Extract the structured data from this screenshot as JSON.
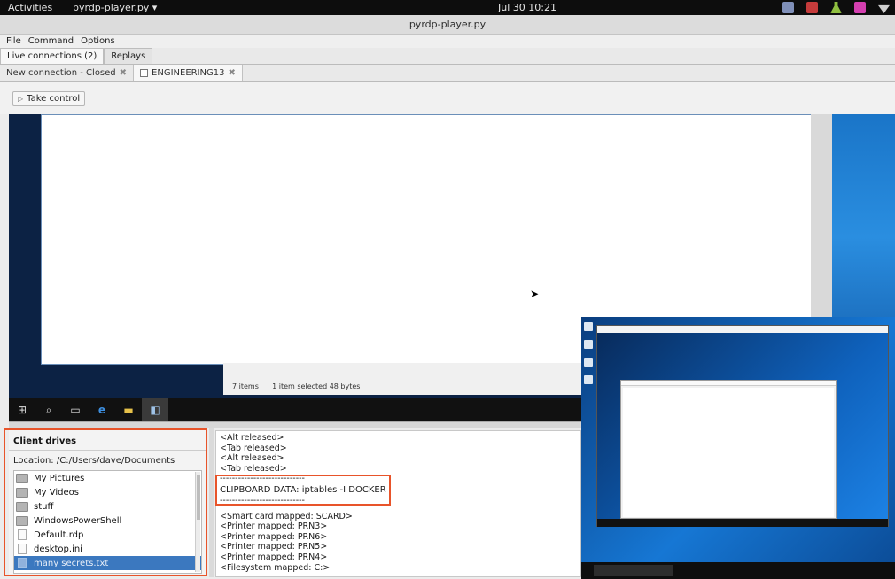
{
  "topbar": {
    "activities": "Activities",
    "app_menu": "pyrdp-player.py ▾",
    "clock": "Jul 30  10:21",
    "tray_icons": [
      "app-icon-1",
      "app-icon-2",
      "flask-icon",
      "app-icon-3",
      "network-icon"
    ]
  },
  "window": {
    "title": "pyrdp-player.py"
  },
  "menubar": {
    "items": [
      "File",
      "Command",
      "Options"
    ]
  },
  "top_tabs": [
    {
      "label": "Live connections (2)",
      "active": true
    },
    {
      "label": "Replays",
      "active": false
    }
  ],
  "conn_tabs": [
    {
      "label": "New connection - Closed",
      "active": false
    },
    {
      "label": "ENGINEERING13",
      "active": true
    }
  ],
  "toolbar": {
    "take_control": "Take control"
  },
  "remote": {
    "status_items": "7 items",
    "status_selected": "1 item selected  48 bytes"
  },
  "client_drives": {
    "title": "Client drives",
    "location": "Location: /C:/Users/dave/Documents",
    "files": [
      {
        "name": "My Pictures",
        "type": "folder"
      },
      {
        "name": "My Videos",
        "type": "folder"
      },
      {
        "name": "stuff",
        "type": "folder"
      },
      {
        "name": "WindowsPowerShell",
        "type": "folder"
      },
      {
        "name": "Default.rdp",
        "type": "file"
      },
      {
        "name": "desktop.ini",
        "type": "file"
      },
      {
        "name": "many secrets.txt",
        "type": "file",
        "selected": true
      }
    ]
  },
  "log": {
    "lines_before": [
      "<Alt released>",
      "<Tab released>",
      "<Alt released>",
      "<Tab released>"
    ],
    "separator": "----------------------------",
    "clipboard": "CLIPBOARD DATA: iptables -I DOCKER",
    "lines_after": [
      "<Smart card mapped: SCARD>",
      "<Printer mapped: PRN3>",
      "<Printer mapped: PRN6>",
      "<Printer mapped: PRN5>",
      "<Printer mapped: PRN4>",
      "<Filesystem mapped: C:>"
    ]
  },
  "colors": {
    "highlight_box": "#e8542a",
    "selection": "#3b78bf"
  }
}
